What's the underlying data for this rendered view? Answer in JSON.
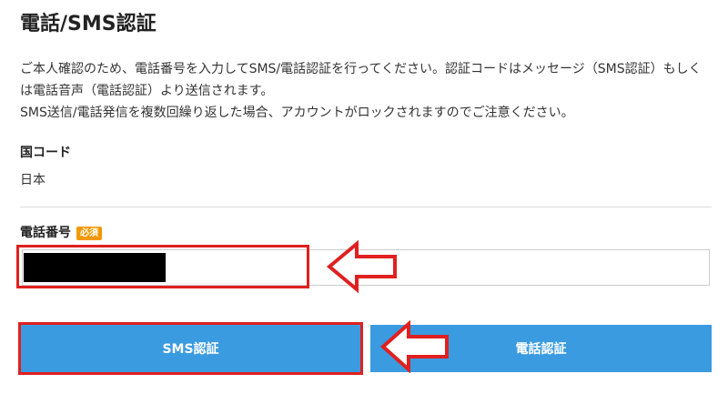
{
  "page": {
    "title": "電話/SMS認証",
    "description": [
      "ご本人確認のため、電話番号を入力してSMS/電話認証を行ってください。認証コードはメッセージ（SMS認証）もしくは電話音声（電話認証）より送信されます。",
      "SMS送信/電話発信を複数回繰り返した場合、アカウントがロックされますのでご注意ください。"
    ]
  },
  "country": {
    "label": "国コード",
    "value": "日本"
  },
  "phone": {
    "label": "電話番号",
    "required_badge": "必須",
    "value": "",
    "placeholder": ""
  },
  "buttons": {
    "sms": "SMS認証",
    "voice": "電話認証"
  },
  "colors": {
    "button": "#3a9be0",
    "badge": "#f39800",
    "highlight": "#e02020"
  },
  "annotations": {
    "arrow_icon": "left-arrow-icon",
    "highlight_color": "#e02020"
  }
}
